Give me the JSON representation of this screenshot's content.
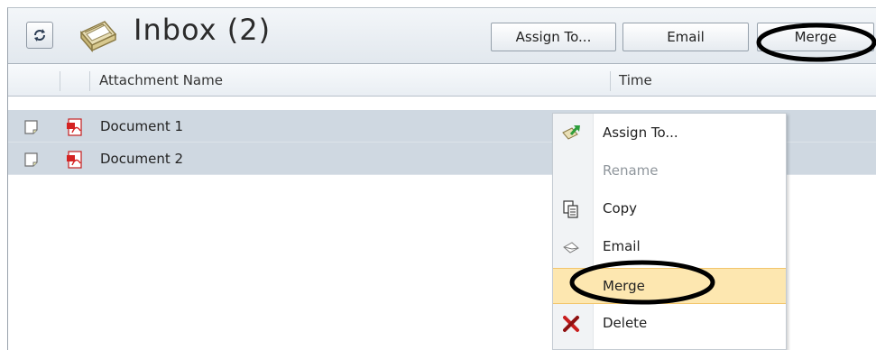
{
  "toolbar": {
    "title": "Inbox (2)",
    "buttons": {
      "assign": "Assign To...",
      "email": "Email",
      "merge": "Merge"
    }
  },
  "columns": {
    "attachment_name": "Attachment Name",
    "time": "Time"
  },
  "rows": [
    {
      "name": "Document 1"
    },
    {
      "name": "Document 2"
    }
  ],
  "context_menu": {
    "items": [
      {
        "label": "Assign To...",
        "icon": "assign-icon",
        "enabled": true
      },
      {
        "label": "Rename",
        "icon": "",
        "enabled": false
      },
      {
        "label": "Copy",
        "icon": "copy-icon",
        "enabled": true
      },
      {
        "label": "Email",
        "icon": "email-icon",
        "enabled": true
      },
      {
        "label": "Merge",
        "icon": "",
        "enabled": true,
        "selected": true
      },
      {
        "label": "Delete",
        "icon": "delete-icon",
        "enabled": true
      }
    ]
  },
  "colors": {
    "row_selected": "#cfd8e1",
    "menu_highlight": "#fde7b0",
    "annotation_oval": "#000000"
  }
}
